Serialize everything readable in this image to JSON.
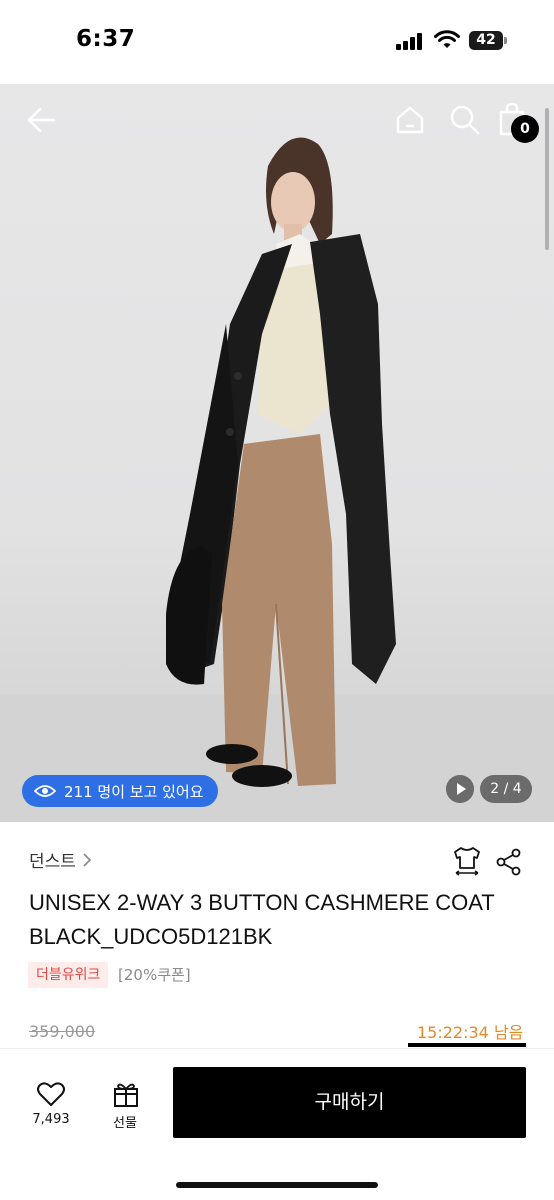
{
  "status_bar": {
    "time": "6:37",
    "battery": "42"
  },
  "header": {
    "back_icon": "arrow-left-icon",
    "home_icon": "home-icon",
    "search_icon": "search-icon",
    "cart_icon": "shopping-bag-icon",
    "cart_count": "0"
  },
  "hero": {
    "viewers_text": "211 명이 보고 있어요",
    "pager": "2 / 4",
    "viewer_icon": "eye-icon",
    "play_icon": "play-icon"
  },
  "product": {
    "brand": "던스트",
    "title": "UNISEX 2-WAY 3 BUTTON CASHMERE COAT BLACK_UDCO5D121BK",
    "tag_week": "더블유위크",
    "tag_coupon": "[20%쿠폰]",
    "price_original": "359,000",
    "timer": "15:22:34 남음"
  },
  "bottom": {
    "like_count": "7,493",
    "gift_label": "선물",
    "buy_label": "구매하기"
  },
  "colors": {
    "accent_blue": "#2e6fe6",
    "timer_orange": "#e08a2c",
    "tag_red": "#e04848",
    "buy_button": "#000000"
  }
}
